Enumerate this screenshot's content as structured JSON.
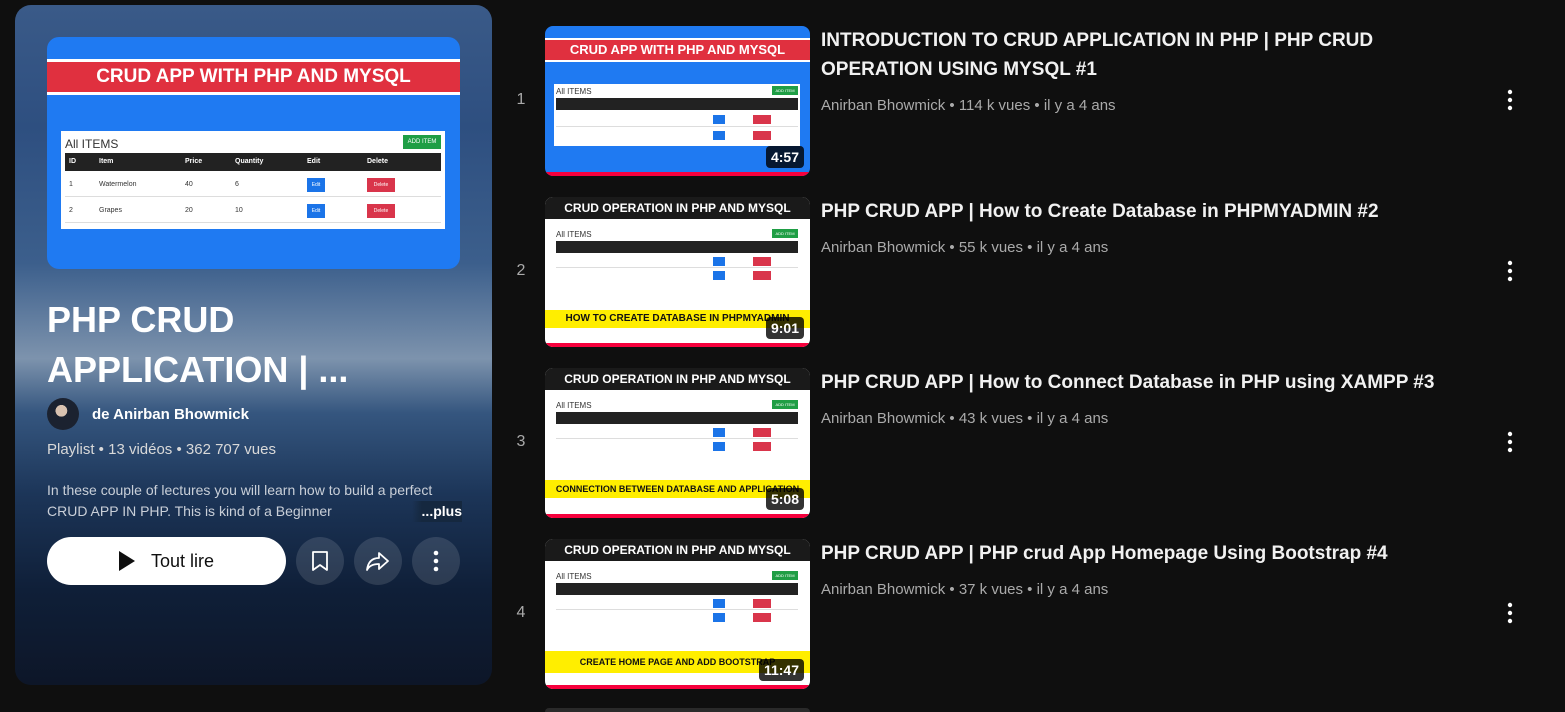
{
  "playlist": {
    "thumbnail": {
      "banner": "CRUD APP WITH PHP AND MYSQL",
      "table_title": "All ITEMS",
      "add_button": "ADD ITEM",
      "columns": [
        "ID",
        "Item",
        "Price",
        "Quantity",
        "Edit",
        "Delete"
      ],
      "rows": [
        [
          "1",
          "Watermelon",
          "40",
          "6",
          "Edit",
          "Delete"
        ],
        [
          "2",
          "Grapes",
          "20",
          "10",
          "Edit",
          "Delete"
        ]
      ]
    },
    "title": "PHP CRUD APPLICATION | ...",
    "owner": "de Anirban Bhowmick",
    "meta": "Playlist • 13 vidéos • 362 707 vues",
    "description": "In these couple of lectures you will learn how to build a perfect CRUD APP IN PHP. This is kind of a Beginner",
    "more_label": "...plus",
    "play_all_label": "Tout lire",
    "icons": {
      "play": "play-icon",
      "save": "bookmark-icon",
      "share": "share-icon",
      "more": "more-vertical-icon"
    }
  },
  "videos": [
    {
      "index": "1",
      "title": "INTRODUCTION TO CRUD APPLICATION IN PHP | PHP CRUD OPERATION USING MYSQL #1",
      "channel": "Anirban Bhowmick",
      "stats": "114 k vues • il y a 4 ans",
      "duration": "4:57",
      "thumb_header": "CRUD APP WITH PHP AND MYSQL",
      "thumb_footer": ""
    },
    {
      "index": "2",
      "title": "PHP CRUD APP | How to Create Database in PHPMYADMIN #2",
      "channel": "Anirban Bhowmick",
      "stats": "55 k vues • il y a 4 ans",
      "duration": "9:01",
      "thumb_header": "CRUD OPERATION IN PHP AND MYSQL",
      "thumb_footer": "HOW TO CREATE DATABASE IN PHPMYADMIN"
    },
    {
      "index": "3",
      "title": "PHP CRUD APP | How to Connect Database in PHP using XAMPP #3",
      "channel": "Anirban Bhowmick",
      "stats": "43 k vues • il y a 4 ans",
      "duration": "5:08",
      "thumb_header": "CRUD OPERATION IN PHP AND MYSQL",
      "thumb_footer": "CONNECTION BETWEEN DATABASE AND APPLICATION"
    },
    {
      "index": "4",
      "title": "PHP CRUD APP | PHP crud App Homepage Using Bootstrap #4",
      "channel": "Anirban Bhowmick",
      "stats": "37 k vues • il y a 4 ans",
      "duration": "11:47",
      "thumb_header": "CRUD OPERATION IN PHP AND MYSQL",
      "thumb_footer": "CREATE HOME PAGE AND ADD BOOTSTRAP"
    }
  ],
  "colors": {
    "background": "#0f0f0f",
    "banner_red": "#e0303f",
    "thumb_blue": "#1f7af2",
    "progress_red": "#f6003c"
  }
}
